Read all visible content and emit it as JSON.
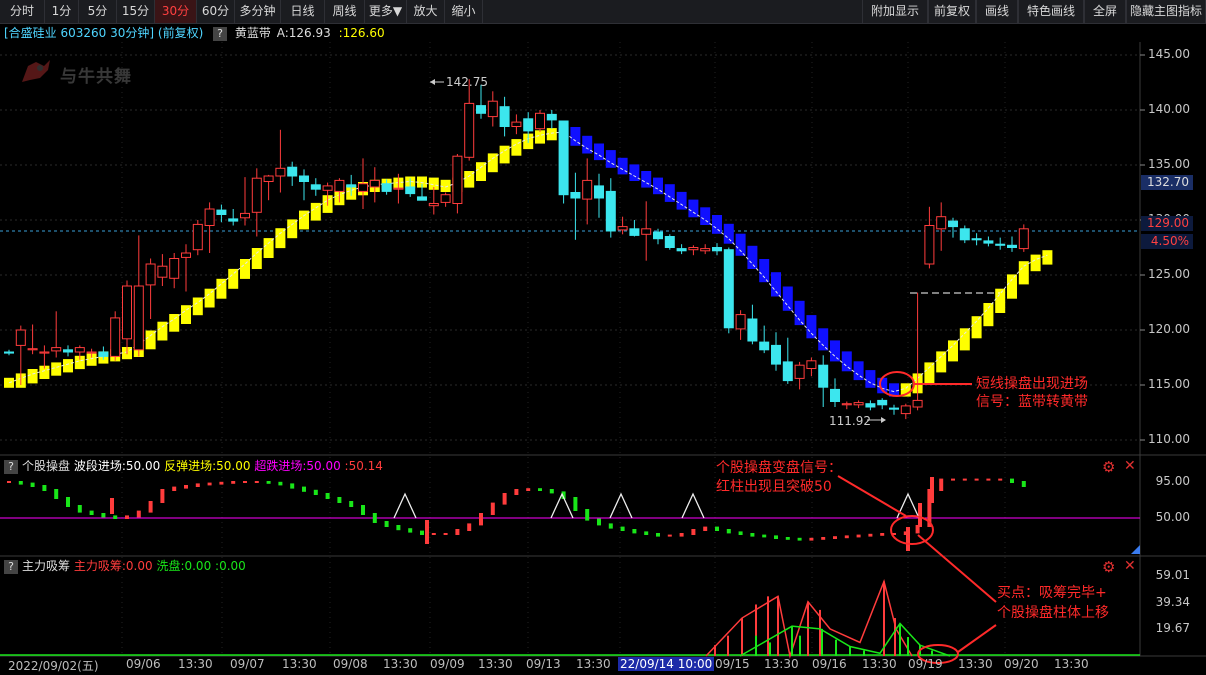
{
  "toolbar": {
    "periods": [
      "分时",
      "1分",
      "5分",
      "15分",
      "30分",
      "60分",
      "多分钟",
      "日线",
      "周线",
      "更多▼",
      "放大",
      "缩小"
    ],
    "active_period": "30分",
    "right_buttons": [
      "附加显示",
      "前复权",
      "画线",
      "特色画线",
      "全屏",
      "隐藏主图指标"
    ]
  },
  "info": {
    "stock": "[合盛硅业 603260 30分钟] (前复权)",
    "indicator": "黄蓝带",
    "a_label": "A:126.93",
    "b_label": ":126.60"
  },
  "watermark": "与牛共舞",
  "panel2": {
    "title": "个股操盘",
    "l1": "波段进场:50.00",
    "l2": "反弹进场:50.00",
    "l3": "超跌进场:50.00",
    "l4": ":50.14"
  },
  "panel3": {
    "title": "主力吸筹",
    "l1": "主力吸筹:0.00",
    "l2": "洗盘:0.00",
    "l3": ":0.00"
  },
  "axis_main": [
    "145.00",
    "140.00",
    "135.00",
    "130.00",
    "125.00",
    "120.00",
    "115.00",
    "110.00"
  ],
  "axis_p2": [
    "95.00",
    "50.00"
  ],
  "axis_p3": [
    "59.01",
    "39.34",
    "19.67"
  ],
  "price_box": "132.70",
  "cur_box": "129.00",
  "pct_box": "4.50%",
  "hi_label": "142.75",
  "lo_label": "111.92",
  "time_labels": [
    "2022/09/02(五)",
    "09/06",
    "13:30",
    "09/07",
    "13:30",
    "09/08",
    "13:30",
    "09/09",
    "13:30",
    "09/13",
    "13:30",
    "22/09/14 10:00",
    "09/15",
    "13:30",
    "09/16",
    "13:30",
    "09/19",
    "13:30",
    "09/20",
    "13:30"
  ],
  "annotations": {
    "a1": [
      "短线操盘出现进场",
      "信号：蓝带转黄带"
    ],
    "a2": [
      "个股操盘变盘信号：",
      "红柱出现且突破50"
    ],
    "a3": [
      "买点：吸筹完毕+",
      "个股操盘柱体上移"
    ]
  },
  "colors": {
    "up": "#ff3c3c",
    "down": "#3ce6ee",
    "yellow": "#ffff00",
    "blue": "#1010ff",
    "green": "#19e619",
    "magenta": "#ff00ff"
  },
  "chart_data": {
    "type": "candlestick",
    "ylim": [
      110,
      145
    ],
    "ohlc": [
      [
        118.0,
        118.2,
        117.7,
        117.9
      ],
      [
        118.6,
        120.4,
        115.0,
        120.0
      ],
      [
        118.2,
        120.5,
        117.8,
        118.3
      ],
      [
        117.9,
        118.6,
        116.5,
        118.0
      ],
      [
        118.1,
        121.7,
        117.5,
        118.4
      ],
      [
        118.2,
        118.6,
        117.6,
        118.0
      ],
      [
        118.0,
        118.6,
        117.3,
        118.4
      ],
      [
        117.9,
        118.3,
        117.5,
        118.0
      ],
      [
        118.0,
        118.5,
        117.3,
        117.6
      ],
      [
        117.6,
        121.7,
        117.2,
        121.1
      ],
      [
        119.2,
        124.5,
        117.8,
        124.0
      ],
      [
        118.2,
        128.6,
        117.6,
        124.0
      ],
      [
        124.1,
        126.5,
        121.0,
        126.0
      ],
      [
        124.8,
        126.9,
        124.0,
        125.8
      ],
      [
        124.7,
        127.0,
        123.8,
        126.5
      ],
      [
        126.6,
        127.8,
        123.5,
        127.0
      ],
      [
        127.3,
        130.0,
        126.8,
        129.6
      ],
      [
        129.5,
        131.6,
        127.0,
        131.0
      ],
      [
        130.9,
        131.4,
        129.8,
        130.5
      ],
      [
        130.1,
        131.0,
        129.5,
        129.9
      ],
      [
        130.2,
        133.9,
        129.5,
        130.6
      ],
      [
        130.7,
        134.7,
        128.5,
        133.8
      ],
      [
        133.5,
        134.1,
        131.8,
        134.0
      ],
      [
        134.0,
        138.2,
        132.5,
        134.7
      ],
      [
        134.8,
        135.3,
        133.1,
        134.0
      ],
      [
        134.0,
        134.6,
        131.8,
        133.5
      ],
      [
        133.2,
        133.8,
        132.2,
        132.8
      ],
      [
        132.7,
        133.4,
        131.3,
        133.1
      ],
      [
        132.6,
        133.8,
        131.6,
        133.6
      ],
      [
        133.2,
        134.1,
        132.2,
        133.0
      ],
      [
        132.6,
        135.6,
        131.0,
        133.3
      ],
      [
        133.0,
        134.8,
        131.6,
        133.6
      ],
      [
        133.3,
        133.7,
        132.3,
        132.6
      ],
      [
        132.8,
        134.2,
        131.5,
        132.9
      ],
      [
        133.0,
        133.8,
        132.1,
        132.4
      ],
      [
        132.1,
        133.3,
        131.8,
        131.8
      ],
      [
        131.3,
        133.0,
        130.5,
        131.5
      ],
      [
        131.6,
        132.5,
        131.2,
        132.3
      ],
      [
        131.5,
        136.0,
        130.6,
        135.8
      ],
      [
        135.7,
        142.8,
        135.4,
        140.6
      ],
      [
        140.4,
        142.3,
        139.2,
        139.7
      ],
      [
        139.4,
        141.7,
        138.5,
        140.8
      ],
      [
        140.3,
        141.2,
        137.6,
        138.5
      ],
      [
        138.5,
        139.6,
        137.8,
        138.9
      ],
      [
        139.2,
        139.8,
        137.0,
        138.1
      ],
      [
        138.3,
        140.0,
        138.0,
        139.7
      ],
      [
        139.6,
        140.0,
        138.3,
        139.1
      ],
      [
        139.0,
        139.0,
        131.5,
        132.3
      ],
      [
        132.5,
        134.3,
        128.2,
        132.0
      ],
      [
        131.9,
        135.6,
        129.6,
        133.6
      ],
      [
        133.1,
        134.2,
        130.2,
        132.0
      ],
      [
        132.6,
        133.8,
        128.4,
        129.0
      ],
      [
        129.1,
        130.3,
        128.7,
        129.4
      ],
      [
        129.2,
        130.0,
        128.5,
        128.6
      ],
      [
        128.7,
        131.7,
        126.3,
        129.2
      ],
      [
        128.9,
        129.2,
        127.8,
        128.3
      ],
      [
        128.5,
        128.7,
        127.3,
        127.5
      ],
      [
        127.4,
        127.8,
        126.9,
        127.2
      ],
      [
        127.3,
        127.7,
        126.8,
        127.5
      ],
      [
        127.2,
        127.8,
        126.9,
        127.4
      ],
      [
        127.5,
        127.9,
        126.8,
        127.2
      ],
      [
        127.3,
        127.5,
        119.7,
        120.2
      ],
      [
        120.1,
        121.8,
        119.1,
        121.4
      ],
      [
        121.0,
        122.3,
        118.7,
        119.0
      ],
      [
        118.9,
        120.4,
        117.9,
        118.2
      ],
      [
        118.6,
        119.8,
        116.3,
        116.9
      ],
      [
        117.1,
        119.3,
        115.1,
        115.4
      ],
      [
        115.6,
        117.1,
        114.6,
        116.8
      ],
      [
        116.5,
        117.5,
        115.8,
        117.2
      ],
      [
        116.8,
        117.7,
        113.0,
        114.8
      ],
      [
        114.6,
        115.6,
        113.0,
        113.5
      ],
      [
        113.2,
        113.5,
        112.8,
        113.3
      ],
      [
        113.2,
        113.6,
        112.9,
        113.4
      ],
      [
        113.3,
        113.6,
        112.7,
        113.0
      ],
      [
        113.6,
        113.8,
        112.8,
        113.2
      ],
      [
        112.9,
        113.2,
        112.3,
        112.8
      ],
      [
        112.4,
        113.3,
        111.9,
        113.1
      ],
      [
        113.0,
        123.4,
        112.7,
        113.6
      ],
      [
        126.0,
        131.2,
        125.6,
        129.5
      ],
      [
        129.2,
        131.6,
        127.2,
        130.3
      ],
      [
        129.9,
        130.2,
        128.4,
        129.4
      ],
      [
        129.2,
        129.5,
        127.9,
        128.2
      ],
      [
        128.3,
        128.8,
        127.7,
        128.2
      ],
      [
        128.1,
        128.5,
        127.6,
        127.9
      ],
      [
        127.8,
        128.4,
        127.3,
        127.7
      ],
      [
        127.7,
        128.5,
        127.1,
        127.5
      ],
      [
        127.4,
        129.6,
        127.1,
        129.2
      ]
    ],
    "band": [
      115.2,
      115.6,
      116.0,
      116.3,
      116.6,
      116.9,
      117.2,
      117.4,
      117.6,
      117.8,
      118.0,
      118.7,
      119.5,
      120.3,
      121.0,
      121.8,
      122.5,
      123.3,
      124.2,
      125.1,
      126.0,
      127.0,
      127.9,
      128.8,
      129.6,
      130.4,
      131.1,
      131.8,
      132.3,
      132.7,
      133.0,
      133.2,
      133.3,
      133.4,
      133.5,
      133.4,
      133.2,
      133.0,
      133.4,
      134.0,
      134.8,
      135.6,
      136.3,
      136.9,
      137.4,
      137.7,
      137.9,
      138.0,
      137.2,
      136.5,
      135.9,
      135.2,
      134.6,
      134.0,
      133.4,
      132.8,
      132.1,
      131.4,
      130.7,
      130.0,
      129.2,
      128.3,
      127.2,
      126.0,
      124.8,
      123.5,
      122.2,
      120.9,
      119.7,
      118.6,
      117.6,
      116.7,
      115.9,
      115.2,
      114.7,
      114.4,
      114.7,
      115.6,
      116.6,
      117.6,
      118.6,
      119.7,
      120.8,
      122.0,
      123.3,
      124.6,
      125.8,
      126.4,
      126.8
    ],
    "band_color": [
      "y",
      "y",
      "y",
      "y",
      "y",
      "y",
      "y",
      "y",
      "y",
      "y",
      "y",
      "y",
      "y",
      "y",
      "y",
      "y",
      "y",
      "y",
      "y",
      "y",
      "y",
      "y",
      "y",
      "y",
      "y",
      "y",
      "y",
      "y",
      "y",
      "y",
      "y",
      "y",
      "y",
      "y",
      "y",
      "y",
      "y",
      "y",
      "y",
      "y",
      "y",
      "y",
      "y",
      "y",
      "y",
      "y",
      "y",
      "b",
      "b",
      "b",
      "b",
      "b",
      "b",
      "b",
      "b",
      "b",
      "b",
      "b",
      "b",
      "b",
      "b",
      "b",
      "b",
      "b",
      "b",
      "b",
      "b",
      "b",
      "b",
      "b",
      "b",
      "b",
      "b",
      "b",
      "b",
      "b",
      "y",
      "y",
      "y",
      "y",
      "y",
      "y",
      "y",
      "y",
      "y",
      "y",
      "y",
      "y",
      "y"
    ]
  }
}
